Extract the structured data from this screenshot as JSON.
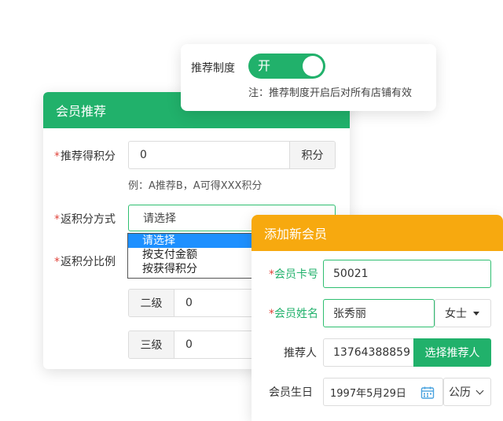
{
  "system_popup": {
    "label": "推荐制度",
    "toggle_text": "开",
    "note": "注：推荐制度开启后对所有店铺有效"
  },
  "member_recommend": {
    "title": "会员推荐",
    "points_label": "推荐得积分",
    "points_value": "0",
    "points_unit": "积分",
    "example": "例：A推荐B，A可得XXX积分",
    "method_label": "返积分方式",
    "method_selected": "请选择",
    "method_options": [
      "请选择",
      "按支付金额",
      "按获得积分"
    ],
    "ratio_label": "返积分比例",
    "levels": [
      {
        "name": "二级",
        "value": "0"
      },
      {
        "name": "三级",
        "value": "0"
      }
    ]
  },
  "add_member": {
    "title": "添加新会员",
    "card_label": "会员卡号",
    "card_value": "50021",
    "name_label": "会员姓名",
    "name_value": "张秀丽",
    "gender": "女士",
    "referrer_label": "推荐人",
    "referrer_value": "13764388859",
    "referrer_button": "选择推荐人",
    "birthday_label": "会员生日",
    "birthday_value": "1997年5月29日",
    "calendar_type": "公历"
  },
  "colors": {
    "green": "#21b16b",
    "orange": "#f7a90f",
    "required_star": "#e0453c",
    "dropdown_highlight": "#1e90ff"
  }
}
